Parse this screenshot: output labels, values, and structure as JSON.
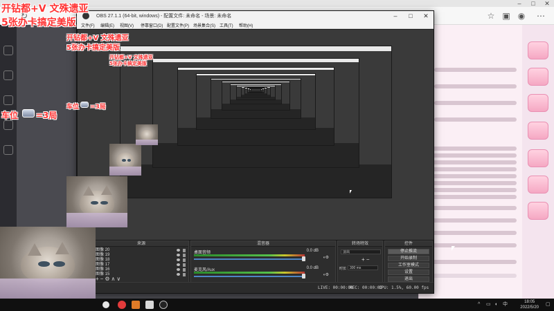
{
  "overlay": {
    "line1": "开钻都+V 文殊遗亚",
    "line2": "5张办卡搞定美版",
    "car_position_prefix": "车位",
    "car_position_suffix": "=3局"
  },
  "obs": {
    "title": "OBS 27.1.1 (64-bit, windows) - 配置文件: 未命名 - 场景: 未命名",
    "menu": [
      "文件(F)",
      "编辑(E)",
      "视图(V)",
      "停靠窗口(D)",
      "配置文件(P)",
      "场景集合(S)",
      "工具(T)",
      "帮助(H)"
    ],
    "docks": {
      "scenes_title": "来源",
      "sources": [
        "图像 20",
        "图像 19",
        "图像 18",
        "图像 17",
        "图像 16",
        "图像 15"
      ],
      "mixer_title": "混音器",
      "mixer": [
        {
          "name": "桌面音频",
          "db": "0.0 dB"
        },
        {
          "name": "麦克风/Aux",
          "db": "0.0 dB"
        }
      ],
      "transitions_title": "转场特效",
      "transition_type": "淡出",
      "duration_label": "时长",
      "duration_value": "300 ms",
      "controls_title": "控件",
      "controls": [
        "停止推流",
        "开始录制",
        "工作室模式",
        "设置",
        "退出"
      ]
    },
    "status": {
      "live": "LIVE: 00:00:00",
      "rec": "REC: 00:00:00",
      "cpu": "CPU: 1.5%, 60.00 fps"
    }
  },
  "taskbar": {
    "time": "18:05",
    "date": "2022/5/20"
  },
  "colors": {
    "overlay_red": "#ff3333",
    "obs_dark": "#2b2b2b",
    "panel_pink": "#fbeff5"
  }
}
